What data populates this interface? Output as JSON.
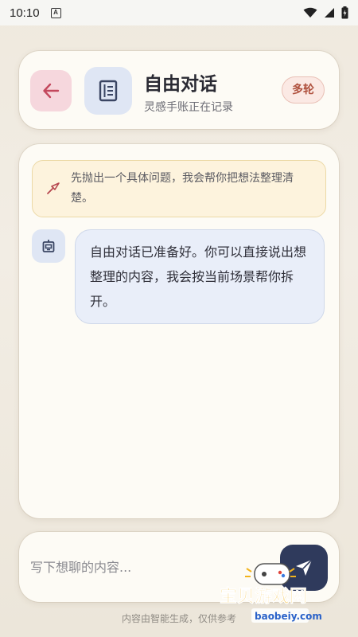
{
  "status_bar": {
    "time": "10:10"
  },
  "header": {
    "title": "自由对话",
    "subtitle": "灵感手账正在记录",
    "mode_badge": "多轮"
  },
  "chat": {
    "tip_text": "先抛出一个具体问题，我会帮你把想法整理清楚。",
    "messages": [
      {
        "role": "assistant",
        "text": "自由对话已准备好。你可以直接说出想整理的内容，我会按当前场景帮你拆开。"
      }
    ]
  },
  "composer": {
    "placeholder": "写下想聊的内容...",
    "footer_note": "内容由智能生成，仅供参考"
  },
  "watermark": {
    "text": "宝贝游戏网",
    "url": "baobeiy.com"
  },
  "colors": {
    "back_button_bg": "#f6d7dd",
    "icon_box_bg": "#dfe6f4",
    "tip_bg": "#fdf3dd",
    "bubble_bg": "#e9eef9",
    "send_button_bg": "#2f3a5c",
    "badge_text": "#b0523f"
  }
}
